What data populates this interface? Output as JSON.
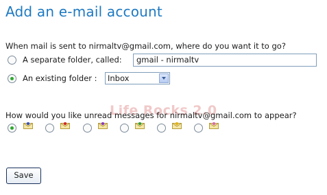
{
  "page_title": "Add an e-mail account",
  "question_folder": "When mail is sent to nirmaltv@gmail.com, where do you want it to go?",
  "option_separate_label": "A separate folder, called:",
  "option_existing_label": "An existing folder :",
  "separate_folder_value": "gmail - nirmaltv",
  "existing_folder_selected": "Inbox",
  "watermark": "Life Rocks 2.0",
  "question_unread": "How would you like unread messages for nirmaltv@gmail.com to appear?",
  "unread_icons": [
    "envelope-blue-dot-icon",
    "envelope-red-dot-icon",
    "envelope-purple-dot-icon",
    "envelope-green-dot-icon",
    "envelope-yellow-dot-icon",
    "envelope-pink-dot-icon"
  ],
  "colors": {
    "accent": "#1d79c2",
    "selected_radio": "#2fa82f"
  },
  "save_label": "Save"
}
